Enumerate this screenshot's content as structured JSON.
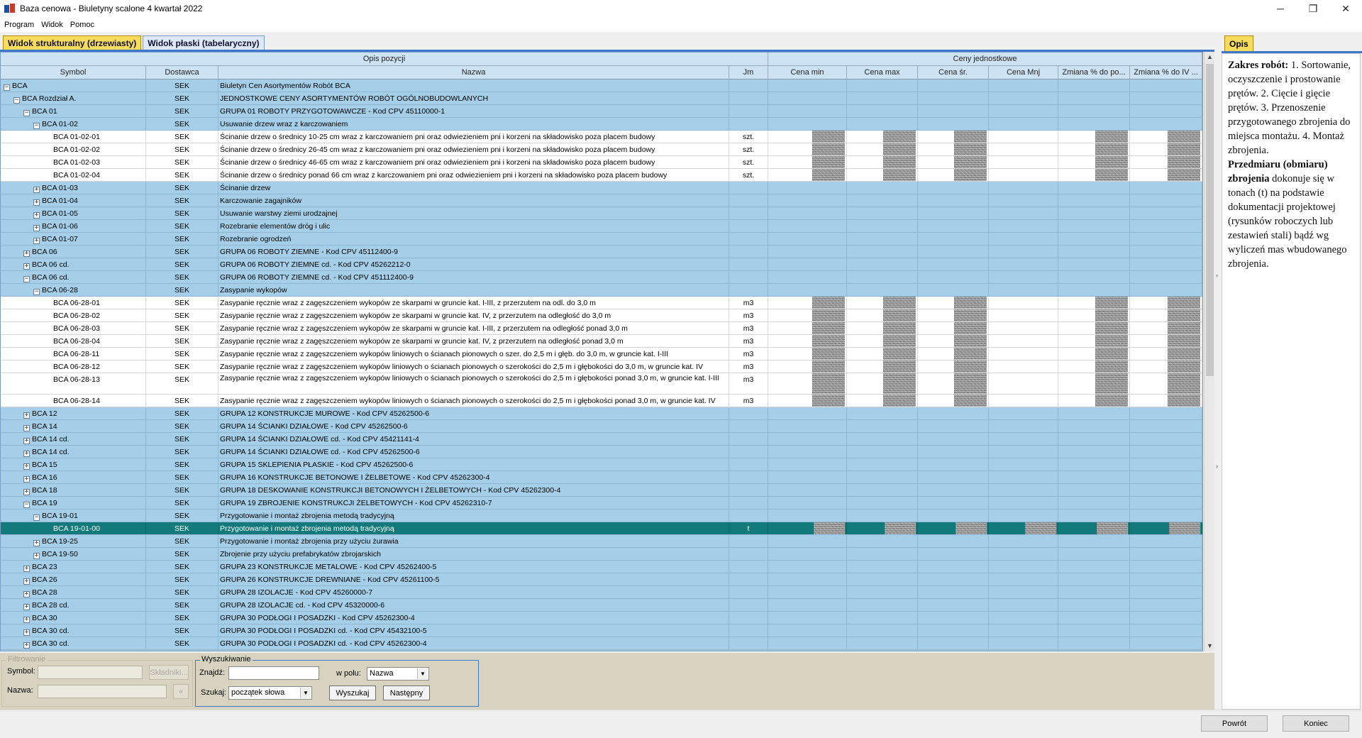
{
  "window": {
    "title": "Baza cenowa - Biuletyny scalone 4 kwartał 2022",
    "controls": {
      "minimize": "─",
      "restore": "❐",
      "close": "✕"
    }
  },
  "menu": [
    "Program",
    "Widok",
    "Pomoc"
  ],
  "tabs": [
    {
      "label": "Widok strukturalny (drzewiasty)",
      "active": true
    },
    {
      "label": "Widok płaski (tabelaryczny)",
      "active": false
    }
  ],
  "grid": {
    "groups": {
      "opis": "Opis pozycji",
      "ceny": "Ceny jednostkowe"
    },
    "columns": [
      "Symbol",
      "Dostawca",
      "Nazwa",
      "Jm",
      "Cena min",
      "Cena max",
      "Cena śr.",
      "Cena Mnj",
      "Zmiana % do po...",
      "Zmiana % do IV ..."
    ],
    "rows": [
      {
        "level": 0,
        "toggle": "−",
        "symbol": "BCA",
        "dostawca": "SEK",
        "nazwa": "Biuletyn Cen Asortymentów Robót BCA",
        "jm": ""
      },
      {
        "level": 1,
        "toggle": "−",
        "symbol": "BCA Rozdział A.",
        "dostawca": "SEK",
        "nazwa": "JEDNOSTKOWE CENY ASORTYMENTÓW ROBÓT OGÓLNOBUDOWLANYCH",
        "jm": ""
      },
      {
        "level": 2,
        "toggle": "−",
        "symbol": "BCA 01",
        "dostawca": "SEK",
        "nazwa": "GRUPA 01 ROBOTY PRZYGOTOWAWCZE - Kod CPV 45110000-1",
        "jm": ""
      },
      {
        "level": 3,
        "toggle": "−",
        "symbol": "BCA 01-02",
        "dostawca": "SEK",
        "nazwa": "Usuwanie drzew wraz z karczowaniem",
        "jm": ""
      },
      {
        "level": 4,
        "leaf": true,
        "symbol": "BCA 01-02-01",
        "dostawca": "SEK",
        "nazwa": "Ścinanie drzew o średnicy 10-25 cm wraz z karczowaniem pni oraz odwiezieniem pni i korzeni na składowisko poza placem budowy",
        "jm": "szt."
      },
      {
        "level": 4,
        "leaf": true,
        "symbol": "BCA 01-02-02",
        "dostawca": "SEK",
        "nazwa": "Ścinanie drzew o średnicy 26-45 cm wraz z karczowaniem pni oraz odwiezieniem pni i korzeni na składowisko poza placem budowy",
        "jm": "szt."
      },
      {
        "level": 4,
        "leaf": true,
        "symbol": "BCA 01-02-03",
        "dostawca": "SEK",
        "nazwa": "Ścinanie drzew o średnicy 46-65 cm wraz z karczowaniem pni oraz odwiezieniem pni i korzeni na składowisko poza placem budowy",
        "jm": "szt."
      },
      {
        "level": 4,
        "leaf": true,
        "symbol": "BCA 01-02-04",
        "dostawca": "SEK",
        "nazwa": "Ścinanie drzew o średnicy ponad 66 cm wraz z karczowaniem pni oraz odwiezieniem pni i korzeni na składowisko poza placem budowy",
        "jm": "szt."
      },
      {
        "level": 3,
        "toggle": "+",
        "symbol": "BCA 01-03",
        "dostawca": "SEK",
        "nazwa": "Ścinanie drzew",
        "jm": ""
      },
      {
        "level": 3,
        "toggle": "+",
        "symbol": "BCA 01-04",
        "dostawca": "SEK",
        "nazwa": "Karczowanie zagajników",
        "jm": ""
      },
      {
        "level": 3,
        "toggle": "+",
        "symbol": "BCA 01-05",
        "dostawca": "SEK",
        "nazwa": "Usuwanie warstwy ziemi urodzajnej",
        "jm": ""
      },
      {
        "level": 3,
        "toggle": "+",
        "symbol": "BCA 01-06",
        "dostawca": "SEK",
        "nazwa": "Rozebranie elementów dróg i ulic",
        "jm": ""
      },
      {
        "level": 3,
        "toggle": "+",
        "symbol": "BCA 01-07",
        "dostawca": "SEK",
        "nazwa": "Rozebranie ogrodzeń",
        "jm": ""
      },
      {
        "level": 2,
        "toggle": "+",
        "symbol": "BCA 06",
        "dostawca": "SEK",
        "nazwa": "GRUPA 06 ROBOTY ZIEMNE - Kod CPV 45112400-9",
        "jm": ""
      },
      {
        "level": 2,
        "toggle": "+",
        "symbol": "BCA 06 cd.",
        "dostawca": "SEK",
        "nazwa": "GRUPA 06 ROBOTY ZIEMNE cd. - Kod CPV 45262212-0",
        "jm": ""
      },
      {
        "level": 2,
        "toggle": "−",
        "symbol": "BCA 06 cd.",
        "dostawca": "SEK",
        "nazwa": "GRUPA 06 ROBOTY ZIEMNE cd. - Kod CPV 451112400-9",
        "jm": ""
      },
      {
        "level": 3,
        "toggle": "−",
        "symbol": "BCA 06-28",
        "dostawca": "SEK",
        "nazwa": "Zasypanie wykopów",
        "jm": ""
      },
      {
        "level": 4,
        "leaf": true,
        "symbol": "BCA 06-28-01",
        "dostawca": "SEK",
        "nazwa": "Zasypanie ręcznie wraz z zagęszczeniem wykopów ze skarpami w gruncie kat. I-III, z przerzutem na odl. do 3,0 m",
        "jm": "m3"
      },
      {
        "level": 4,
        "leaf": true,
        "symbol": "BCA 06-28-02",
        "dostawca": "SEK",
        "nazwa": "Zasypanie ręcznie wraz z zagęszczeniem wykopów ze skarpami w gruncie kat. IV, z przerzutem na odległość do 3,0 m",
        "jm": "m3"
      },
      {
        "level": 4,
        "leaf": true,
        "symbol": "BCA 06-28-03",
        "dostawca": "SEK",
        "nazwa": "Zasypanie ręcznie wraz z zagęszczeniem wykopów ze skarpami w gruncie kat. I-III, z przerzutem na odległość ponad 3,0 m",
        "jm": "m3"
      },
      {
        "level": 4,
        "leaf": true,
        "symbol": "BCA 06-28-04",
        "dostawca": "SEK",
        "nazwa": "Zasypanie ręcznie wraz z zagęszczeniem wykopów ze skarpami w gruncie kat. IV, z przerzutem na odległość ponad 3,0 m",
        "jm": "m3"
      },
      {
        "level": 4,
        "leaf": true,
        "symbol": "BCA 06-28-11",
        "dostawca": "SEK",
        "nazwa": "Zasypanie ręcznie wraz z zagęszczeniem wykopów liniowych o ścianach pionowych o szer. do 2,5 m i głęb. do 3,0 m, w gruncie kat. I-III",
        "jm": "m3"
      },
      {
        "level": 4,
        "leaf": true,
        "symbol": "BCA 06-28-12",
        "dostawca": "SEK",
        "nazwa": "Zasypanie ręcznie wraz z zagęszczeniem wykopów liniowych o ścianach pionowych o szerokości do 2,5 m i głębokości do 3,0 m, w gruncie kat. IV",
        "jm": "m3"
      },
      {
        "level": 4,
        "leaf": true,
        "tall": true,
        "symbol": "BCA 06-28-13",
        "dostawca": "SEK",
        "nazwa": "Zasypanie ręcznie wraz z zagęszczeniem wykopów liniowych o ścianach pionowych o szerokości do 2,5 m i głębokości ponad 3,0 m, w gruncie kat. I-III",
        "jm": "m3"
      },
      {
        "level": 4,
        "leaf": true,
        "symbol": "BCA 06-28-14",
        "dostawca": "SEK",
        "nazwa": "Zasypanie ręcznie wraz z zagęszczeniem wykopów liniowych o ścianach pionowych o szerokości do 2,5 m i głębokości ponad 3,0 m, w gruncie kat. IV",
        "jm": "m3"
      },
      {
        "level": 2,
        "toggle": "+",
        "symbol": "BCA 12",
        "dostawca": "SEK",
        "nazwa": "GRUPA 12 KONSTRUKCJE MUROWE - Kod CPV 45262500-6",
        "jm": ""
      },
      {
        "level": 2,
        "toggle": "+",
        "symbol": "BCA 14",
        "dostawca": "SEK",
        "nazwa": "GRUPA 14 ŚCIANKI DZIAŁOWE - Kod CPV 45262500-6",
        "jm": ""
      },
      {
        "level": 2,
        "toggle": "+",
        "symbol": "BCA 14 cd.",
        "dostawca": "SEK",
        "nazwa": "GRUPA 14 ŚCIANKI DZIAŁOWE cd. - Kod CPV 45421141-4",
        "jm": ""
      },
      {
        "level": 2,
        "toggle": "+",
        "symbol": "BCA 14 cd.",
        "dostawca": "SEK",
        "nazwa": "GRUPA 14 ŚCIANKI DZIAŁOWE cd. - Kod CPV 45262500-6",
        "jm": ""
      },
      {
        "level": 2,
        "toggle": "+",
        "symbol": "BCA 15",
        "dostawca": "SEK",
        "nazwa": "GRUPA 15 SKLEPIENIA PŁASKIE - Kod CPV 45262500-6",
        "jm": ""
      },
      {
        "level": 2,
        "toggle": "+",
        "symbol": "BCA 16",
        "dostawca": "SEK",
        "nazwa": "GRUPA 16 KONSTRUKCJE BETONOWE I ŻELBETOWE - Kod CPV 45262300-4",
        "jm": ""
      },
      {
        "level": 2,
        "toggle": "+",
        "symbol": "BCA 18",
        "dostawca": "SEK",
        "nazwa": "GRUPA 18 DESKOWANIE KONSTRUKCJI BETONOWYCH I ŻELBETOWYCH - Kod CPV 45262300-4",
        "jm": ""
      },
      {
        "level": 2,
        "toggle": "−",
        "symbol": "BCA 19",
        "dostawca": "SEK",
        "nazwa": "GRUPA 19 ZBROJENIE KONSTRUKCJI ŻELBETOWYCH - Kod CPV 45262310-7",
        "jm": ""
      },
      {
        "level": 3,
        "toggle": "−",
        "symbol": "BCA 19-01",
        "dostawca": "SEK",
        "nazwa": "Przygotowanie i montaż zbrojenia metodą tradycyjną",
        "jm": ""
      },
      {
        "level": 4,
        "leaf": true,
        "selected": true,
        "symbol": "BCA 19-01-00",
        "dostawca": "SEK",
        "nazwa": "Przygotowanie i montaż zbrojenia metodą tradycyjną",
        "jm": "t"
      },
      {
        "level": 3,
        "toggle": "+",
        "symbol": "BCA 19-25",
        "dostawca": "SEK",
        "nazwa": "Przygotowanie i montaż zbrojenia przy użyciu żurawia",
        "jm": ""
      },
      {
        "level": 3,
        "toggle": "+",
        "symbol": "BCA 19-50",
        "dostawca": "SEK",
        "nazwa": "Zbrojenie przy użyciu prefabrykatów zbrojarskich",
        "jm": ""
      },
      {
        "level": 2,
        "toggle": "+",
        "symbol": "BCA 23",
        "dostawca": "SEK",
        "nazwa": "GRUPA 23 KONSTRUKCJE METALOWE - Kod CPV 45262400-5",
        "jm": ""
      },
      {
        "level": 2,
        "toggle": "+",
        "symbol": "BCA 26",
        "dostawca": "SEK",
        "nazwa": "GRUPA 26 KONSTRUKCJE DREWNIANE - Kod CPV 45261100-5",
        "jm": ""
      },
      {
        "level": 2,
        "toggle": "+",
        "symbol": "BCA 28",
        "dostawca": "SEK",
        "nazwa": "GRUPA 28 IZOLACJE - Kod CPV 45260000-7",
        "jm": ""
      },
      {
        "level": 2,
        "toggle": "+",
        "symbol": "BCA 28 cd.",
        "dostawca": "SEK",
        "nazwa": "GRUPA 28 IZOLACJE cd. - Kod CPV 45320000-6",
        "jm": ""
      },
      {
        "level": 2,
        "toggle": "+",
        "symbol": "BCA 30",
        "dostawca": "SEK",
        "nazwa": "GRUPA 30 PODŁOGI I POSADZKI - Kod CPV 45262300-4",
        "jm": ""
      },
      {
        "level": 2,
        "toggle": "+",
        "symbol": "BCA 30 cd.",
        "dostawca": "SEK",
        "nazwa": "GRUPA 30 PODŁOGI I POSADZKI cd. - Kod CPV 45432100-5",
        "jm": ""
      },
      {
        "level": 2,
        "toggle": "+",
        "symbol": "BCA 30 cd.",
        "dostawca": "SEK",
        "nazwa": "GRUPA 30 PODŁOGI I POSADZKI cd. - Kod CPV 45262300-4",
        "jm": ""
      }
    ]
  },
  "filter": {
    "legend": "Filtrowanie",
    "symbol_label": "Symbol:",
    "nazwa_label": "Nazwa:",
    "skladniki_button": "Składniki...",
    "clear_button": "«"
  },
  "search": {
    "legend": "Wyszukiwanie",
    "znajdz_label": "Znajdź:",
    "w_polu_label": "w polu:",
    "w_polu_value": "Nazwa",
    "szukaj_label": "Szukaj:",
    "szukaj_value": "początek słowa",
    "wyszukaj_button": "Wyszukaj",
    "nastepny_button": "Następny"
  },
  "opis": {
    "tab": "Opis",
    "p1_bold": "Zakres robót:",
    "p1_text": " 1. Sortowanie, oczyszczenie i prostowanie prętów. 2. Cięcie i gięcie prętów. 3. Przenoszenie przygotowanego zbrojenia do miejsca montażu. 4. Montaż zbrojenia.",
    "p2_bold": "Przedmiaru (obmiaru) zbrojenia",
    "p2_text": " dokonuje się w tonach (t) na podstawie dokumentacji projektowej (rysunków roboczych lub zestawień stali) bądź wg wyliczeń mas wbudowanego zbrojenia."
  },
  "footer": {
    "back": "Powrót",
    "end": "Koniec"
  },
  "colors": {
    "accent_tab": "#f9dc5c",
    "group_row": "#a5cfe8",
    "selected_row": "#127a7a"
  }
}
